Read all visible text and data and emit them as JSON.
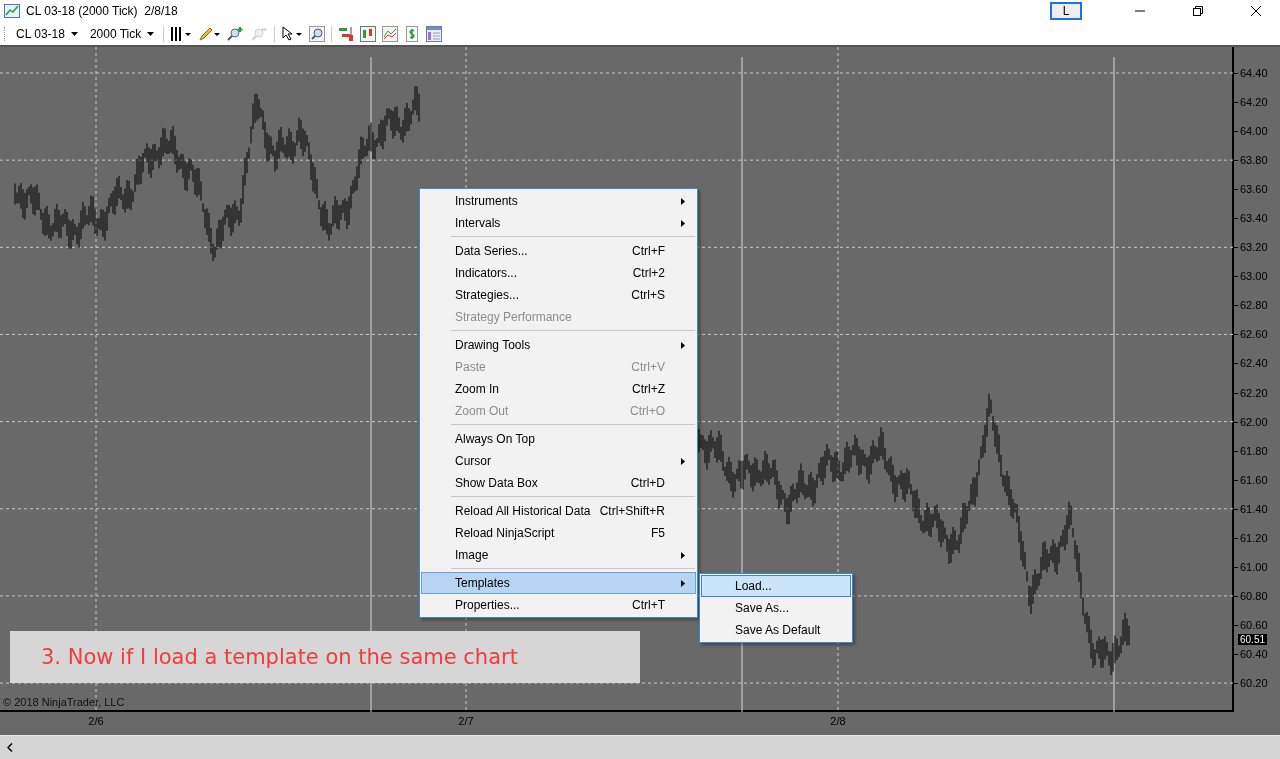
{
  "window": {
    "title": "CL 03-18 (2000 Tick)  2/8/18",
    "layout_button": "L"
  },
  "toolbar": {
    "instrument": "CL 03-18",
    "interval": "2000 Tick"
  },
  "chart": {
    "y_axis_labels": [
      "64.40",
      "64.20",
      "64.00",
      "63.80",
      "63.60",
      "63.40",
      "63.20",
      "63.00",
      "62.80",
      "62.60",
      "62.40",
      "62.20",
      "62.00",
      "61.80",
      "61.60",
      "61.40",
      "61.20",
      "61.00",
      "60.80",
      "60.60",
      "60.40",
      "60.20"
    ],
    "x_axis_labels": [
      "2/6",
      "2/7",
      "2/8"
    ],
    "last_price": "60.51",
    "copyright": "© 2018 NinjaTrader, LLC"
  },
  "context_menu": {
    "groups": [
      [
        {
          "label": "Instruments",
          "has_submenu": true,
          "disabled": false,
          "selected": false
        },
        {
          "label": "Intervals",
          "has_submenu": true,
          "disabled": false,
          "selected": false
        }
      ],
      [
        {
          "label": "Data Series...",
          "shortcut": "Ctrl+F",
          "has_submenu": false,
          "disabled": false,
          "selected": false
        },
        {
          "label": "Indicators...",
          "shortcut": "Ctrl+2",
          "has_submenu": false,
          "disabled": false,
          "selected": false
        },
        {
          "label": "Strategies...",
          "shortcut": "Ctrl+S",
          "has_submenu": false,
          "disabled": false,
          "selected": false
        },
        {
          "label": "Strategy Performance",
          "has_submenu": false,
          "disabled": true,
          "selected": false
        }
      ],
      [
        {
          "label": "Drawing Tools",
          "has_submenu": true,
          "disabled": false,
          "selected": false
        },
        {
          "label": "Paste",
          "shortcut": "Ctrl+V",
          "has_submenu": false,
          "disabled": true,
          "selected": false
        },
        {
          "label": "Zoom In",
          "shortcut": "Ctrl+Z",
          "has_submenu": false,
          "disabled": false,
          "selected": false
        },
        {
          "label": "Zoom Out",
          "shortcut": "Ctrl+O",
          "has_submenu": false,
          "disabled": true,
          "selected": false
        }
      ],
      [
        {
          "label": "Always On Top",
          "has_submenu": false,
          "disabled": false,
          "selected": false
        },
        {
          "label": "Cursor",
          "has_submenu": true,
          "disabled": false,
          "selected": false
        },
        {
          "label": "Show Data Box",
          "shortcut": "Ctrl+D",
          "has_submenu": false,
          "disabled": false,
          "selected": false
        }
      ],
      [
        {
          "label": "Reload All Historical Data",
          "shortcut": "Ctrl+Shift+R",
          "has_submenu": false,
          "disabled": false,
          "selected": false
        },
        {
          "label": "Reload NinjaScript",
          "shortcut": "F5",
          "has_submenu": false,
          "disabled": false,
          "selected": false
        },
        {
          "label": "Image",
          "has_submenu": true,
          "disabled": false,
          "selected": false
        }
      ],
      [
        {
          "label": "Templates",
          "has_submenu": true,
          "disabled": false,
          "selected": true
        },
        {
          "label": "Properties...",
          "shortcut": "Ctrl+T",
          "has_submenu": false,
          "disabled": false,
          "selected": false
        }
      ]
    ]
  },
  "submenu": {
    "items": [
      {
        "label": "Load...",
        "selected": true
      },
      {
        "label": "Save As...",
        "selected": false
      },
      {
        "label": "Save As Default",
        "selected": false
      }
    ]
  },
  "annotation": "3. Now if I load a template on the same chart"
}
